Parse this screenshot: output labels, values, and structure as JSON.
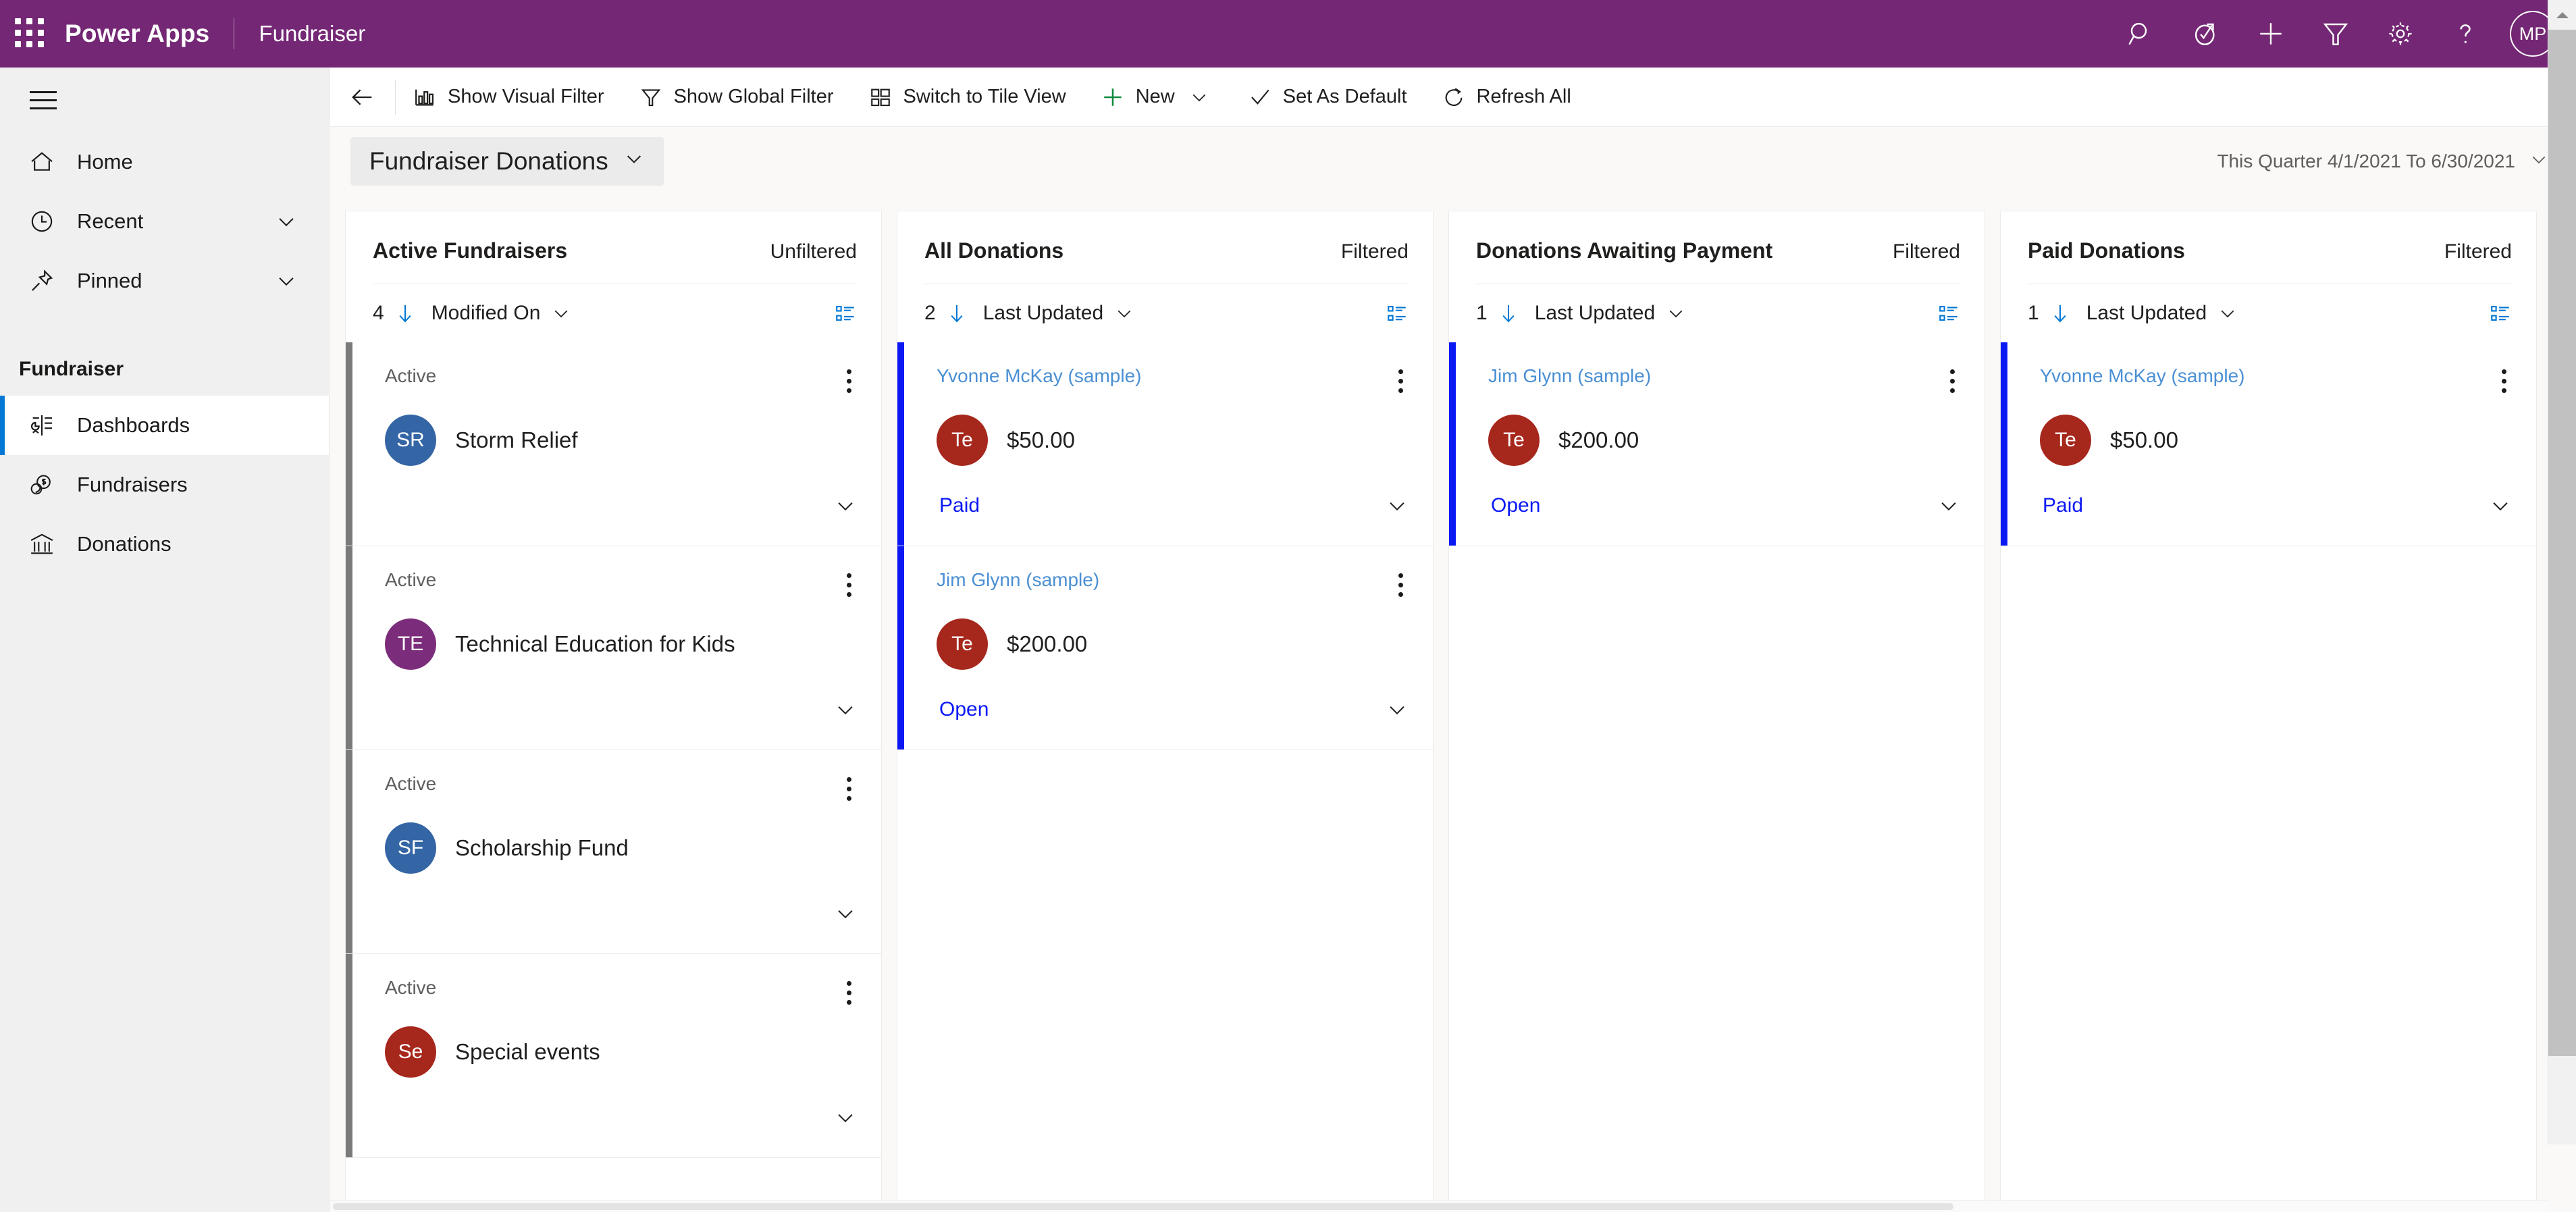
{
  "topbar": {
    "waffle_icon": "app-launcher-icon",
    "brand": "Power Apps",
    "app_name": "Fundraiser",
    "brand_bg": "#742774",
    "icons": [
      {
        "name": "search-icon",
        "label": "Search"
      },
      {
        "name": "assistant-icon",
        "label": "Assistant"
      },
      {
        "name": "new-icon",
        "label": "New"
      },
      {
        "name": "filter-icon",
        "label": "Filter"
      },
      {
        "name": "settings-gear-icon",
        "label": "Settings"
      },
      {
        "name": "help-question-icon",
        "label": "Help"
      }
    ],
    "avatar_initials": "MP"
  },
  "sidebar": {
    "hamburger_icon": "hamburger-menu-icon",
    "items": [
      {
        "label": "Home",
        "icon": "home-icon",
        "chevron": false,
        "selected": false
      },
      {
        "label": "Recent",
        "icon": "clock-icon",
        "chevron": true,
        "selected": false
      },
      {
        "label": "Pinned",
        "icon": "pin-icon",
        "chevron": true,
        "selected": false
      }
    ],
    "section_label": "Fundraiser",
    "group_items": [
      {
        "label": "Dashboards",
        "icon": "dashboards-icon",
        "selected": true
      },
      {
        "label": "Fundraisers",
        "icon": "coins-icon",
        "selected": false
      },
      {
        "label": "Donations",
        "icon": "bank-icon",
        "selected": false
      }
    ]
  },
  "commandbar": {
    "back_icon": "back-arrow-icon",
    "buttons": [
      {
        "label": "Show Visual Filter",
        "icon": "bar-chart-icon",
        "caret": false
      },
      {
        "label": "Show Global Filter",
        "icon": "funnel-icon",
        "caret": false
      },
      {
        "label": "Switch to Tile View",
        "icon": "tile-view-icon",
        "caret": false
      },
      {
        "label": "New",
        "icon": "plus-icon",
        "caret": true
      },
      {
        "label": "Set As Default",
        "icon": "checkmark-icon",
        "caret": false
      },
      {
        "label": "Refresh All",
        "icon": "refresh-icon",
        "caret": false
      }
    ]
  },
  "dashboard": {
    "title": "Fundraiser Donations",
    "title_chevron_icon": "chevron-down-icon",
    "date_range": "This Quarter 4/1/2021 To 6/30/2021",
    "date_chevron_icon": "chevron-down-icon"
  },
  "streams": [
    {
      "title": "Active Fundraisers",
      "filter_state": "Unfiltered",
      "count": "4",
      "sort_field": "Modified On",
      "sort_direction_icon": "sort-descending-arrow-icon",
      "list_view_icon": "list-layout-icon",
      "cards": [
        {
          "sub": "Active",
          "sub_is_link": false,
          "initials": "SR",
          "avatar_color": "#3465a4",
          "main": "Storm Relief",
          "status": "",
          "accent": "gray"
        },
        {
          "sub": "Active",
          "sub_is_link": false,
          "initials": "TE",
          "avatar_color": "#7b2d7b",
          "main": "Technical Education for Kids",
          "status": "",
          "accent": "gray"
        },
        {
          "sub": "Active",
          "sub_is_link": false,
          "initials": "SF",
          "avatar_color": "#3465a4",
          "main": "Scholarship Fund",
          "status": "",
          "accent": "gray"
        },
        {
          "sub": "Active",
          "sub_is_link": false,
          "initials": "Se",
          "avatar_color": "#a6271c",
          "main": "Special events",
          "status": "",
          "accent": "gray"
        }
      ]
    },
    {
      "title": "All Donations",
      "filter_state": "Filtered",
      "count": "2",
      "sort_field": "Last Updated",
      "sort_direction_icon": "sort-descending-arrow-icon",
      "list_view_icon": "list-layout-icon",
      "cards": [
        {
          "sub": "Yvonne McKay (sample)",
          "sub_is_link": true,
          "initials": "Te",
          "avatar_color": "#a6271c",
          "main": "$50.00",
          "status": "Paid",
          "accent": "blue"
        },
        {
          "sub": "Jim Glynn (sample)",
          "sub_is_link": true,
          "initials": "Te",
          "avatar_color": "#a6271c",
          "main": "$200.00",
          "status": "Open",
          "accent": "blue"
        }
      ]
    },
    {
      "title": "Donations Awaiting Payment",
      "filter_state": "Filtered",
      "count": "1",
      "sort_field": "Last Updated",
      "sort_direction_icon": "sort-descending-arrow-icon",
      "list_view_icon": "list-layout-icon",
      "cards": [
        {
          "sub": "Jim Glynn (sample)",
          "sub_is_link": true,
          "initials": "Te",
          "avatar_color": "#a6271c",
          "main": "$200.00",
          "status": "Open",
          "accent": "blue"
        }
      ]
    },
    {
      "title": "Paid Donations",
      "filter_state": "Filtered",
      "count": "1",
      "sort_field": "Last Updated",
      "sort_direction_icon": "sort-descending-arrow-icon",
      "list_view_icon": "list-layout-icon",
      "cards": [
        {
          "sub": "Yvonne McKay (sample)",
          "sub_is_link": true,
          "initials": "Te",
          "avatar_color": "#a6271c",
          "main": "$50.00",
          "status": "Paid",
          "accent": "blue"
        }
      ]
    }
  ],
  "scrollbars": {
    "vertical_name": "vertical-scrollbar",
    "horizontal_name": "horizontal-scrollbar"
  }
}
